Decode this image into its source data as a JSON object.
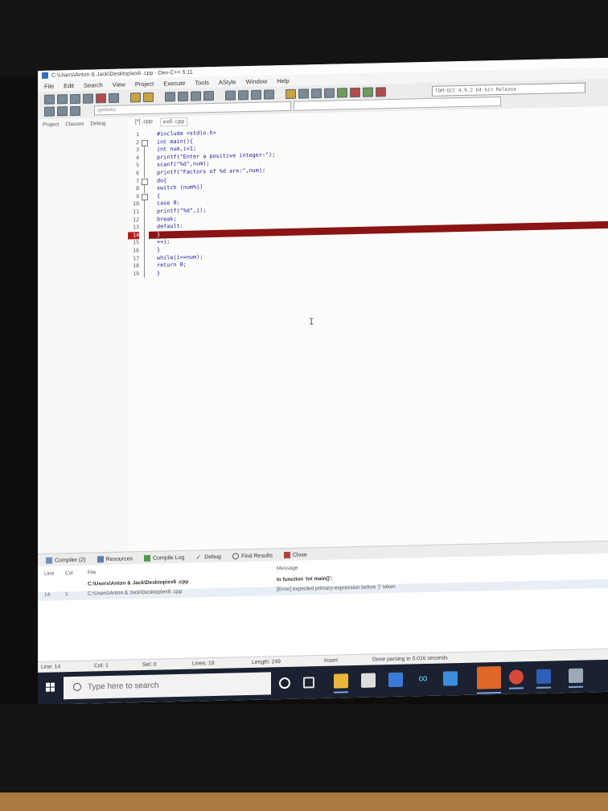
{
  "window": {
    "title": "C:\\Users\\Anton & Jack\\Desktop\\ex6 .cpp - Dev-C++ 5.11"
  },
  "menu": [
    "File",
    "Edit",
    "Search",
    "View",
    "Project",
    "Execute",
    "Tools",
    "AStyle",
    "Window",
    "Help"
  ],
  "toolbar": {
    "compiler": "TDM-GCC 4.9.2 64-bit Release",
    "scope": "(globals)"
  },
  "left_panel": {
    "tabs": [
      "Project",
      "Classes",
      "Debug"
    ]
  },
  "editor": {
    "tabs": [
      "[*] .cpp",
      "ex6 .cpp"
    ],
    "lines": [
      {
        "n": "1",
        "text": "#include <stdio.h>"
      },
      {
        "n": "2",
        "text": "int main(){"
      },
      {
        "n": "3",
        "text": "int num,i=1;"
      },
      {
        "n": "4",
        "text": "printf(\"Enter a positive integer:\");"
      },
      {
        "n": "5",
        "text": "scanf(\"%d\",num);"
      },
      {
        "n": "6",
        "text": "printf(\"Factors of %d are:\",num);"
      },
      {
        "n": "7",
        "text": "do{"
      },
      {
        "n": "8",
        "text": "switch (num%i)"
      },
      {
        "n": "9",
        "text": "{"
      },
      {
        "n": "10",
        "text": "case 0:"
      },
      {
        "n": "11",
        "text": "printf(\"%d\",i);"
      },
      {
        "n": "12",
        "text": "break;"
      },
      {
        "n": "13",
        "text": "default:"
      },
      {
        "n": "14",
        "text": "}"
      },
      {
        "n": "15",
        "text": "++i;"
      },
      {
        "n": "16",
        "text": "}"
      },
      {
        "n": "17",
        "text": "while(i<=num);"
      },
      {
        "n": "18",
        "text": "return 0;"
      },
      {
        "n": "19",
        "text": "}"
      }
    ],
    "error_line": "14"
  },
  "bottom_tabs": [
    "Compiler (2)",
    "Resources",
    "Compile Log",
    "Debug",
    "Find Results",
    "Close"
  ],
  "messages": {
    "headers": {
      "line": "Line",
      "col": "Col",
      "file": "File",
      "message": "Message"
    },
    "rows": [
      {
        "line": "",
        "col": "",
        "file": "C:\\Users\\Anton & Jack\\Desktop\\ex6 .cpp",
        "message": "In function 'int main()':"
      },
      {
        "line": "14",
        "col": "1",
        "file": "C:\\Users\\Anton & Jack\\Desktop\\ex6 .cpp",
        "message": "[Error] expected primary-expression before '}' token"
      }
    ]
  },
  "status": {
    "line": "Line:  14",
    "col": "Col:   1",
    "sel": "Sel:   0",
    "lines": "Lines:   19",
    "length": "Length:  249",
    "mode": "Insert",
    "message": "Done parsing in 0.016 seconds"
  },
  "taskbar": {
    "search_placeholder": "Type here to search"
  }
}
